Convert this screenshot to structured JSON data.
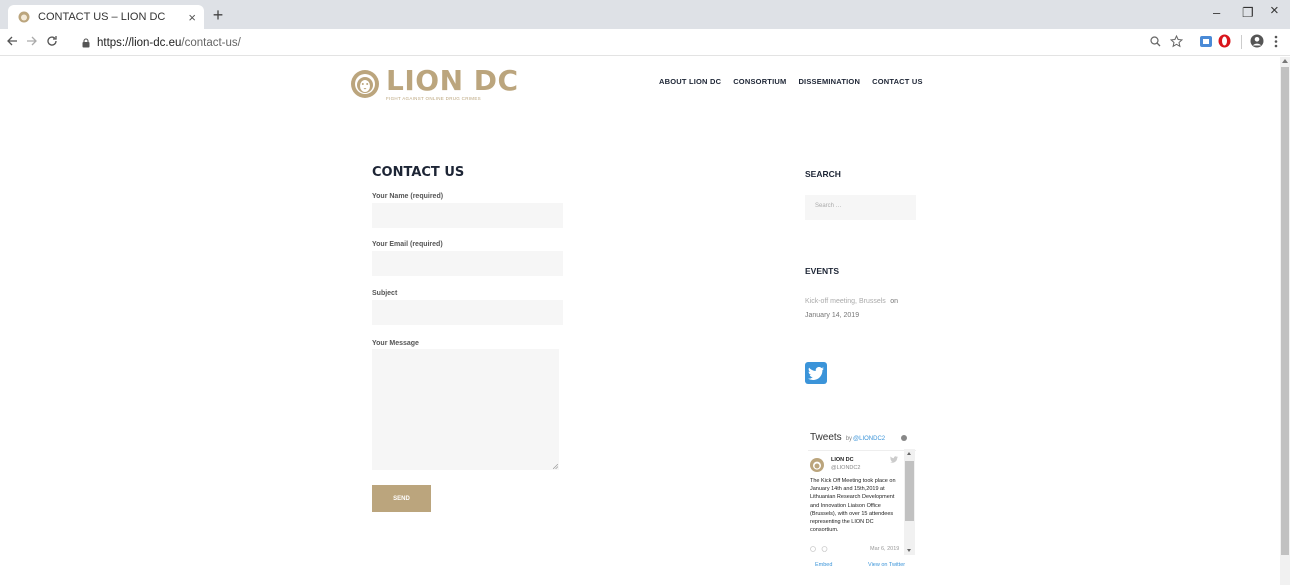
{
  "browser": {
    "tab_title": "CONTACT US – LION DC",
    "tab_close": "×",
    "new_tab": "+",
    "url_host": "https://lion-dc.eu",
    "url_path": "/contact-us/",
    "window_controls": {
      "minimize": "–",
      "restore": "❐",
      "close": "×"
    },
    "icons": [
      "back-icon",
      "forward-icon",
      "reload-icon",
      "lock-icon",
      "zoom-icon",
      "star-icon",
      "extension-icon",
      "opera-icon",
      "account-icon",
      "menu-icon"
    ]
  },
  "site": {
    "brand": "LION DC",
    "tagline": "FIGHT AGAINST ONLINE DRUG CRIMES",
    "accent_color": "#bba57d",
    "nav": [
      "ABOUT LION DC",
      "CONSORTIUM",
      "DISSEMINATION",
      "CONTACT US"
    ]
  },
  "contact_form": {
    "title": "CONTACT US",
    "name_label": "Your Name (required)",
    "email_label": "Your Email (required)",
    "subject_label": "Subject",
    "message_label": "Your Message",
    "send_label": "SEND"
  },
  "sidebar": {
    "search_title": "SEARCH",
    "search_placeholder": "Search …",
    "events_title": "EVENTS",
    "event_link": "Kick-off meeting, Brussels",
    "event_on": "on",
    "event_date": "January 14, 2019"
  },
  "tweets": {
    "title": "Tweets",
    "by": "by",
    "handle_link": "@LIONDC2",
    "author_name": "LION DC",
    "author_handle": "@LIONDC2",
    "text": "The Kick Off Meeting took place on January 14th and 15th,2019 at Lithuanian Research Development and Innovation Liaison Office (Brussels), with over 15 attendees representing the LION DC consortium.",
    "date": "Mar 6, 2019",
    "embed": "Embed",
    "view_on_twitter": "View on Twitter"
  }
}
